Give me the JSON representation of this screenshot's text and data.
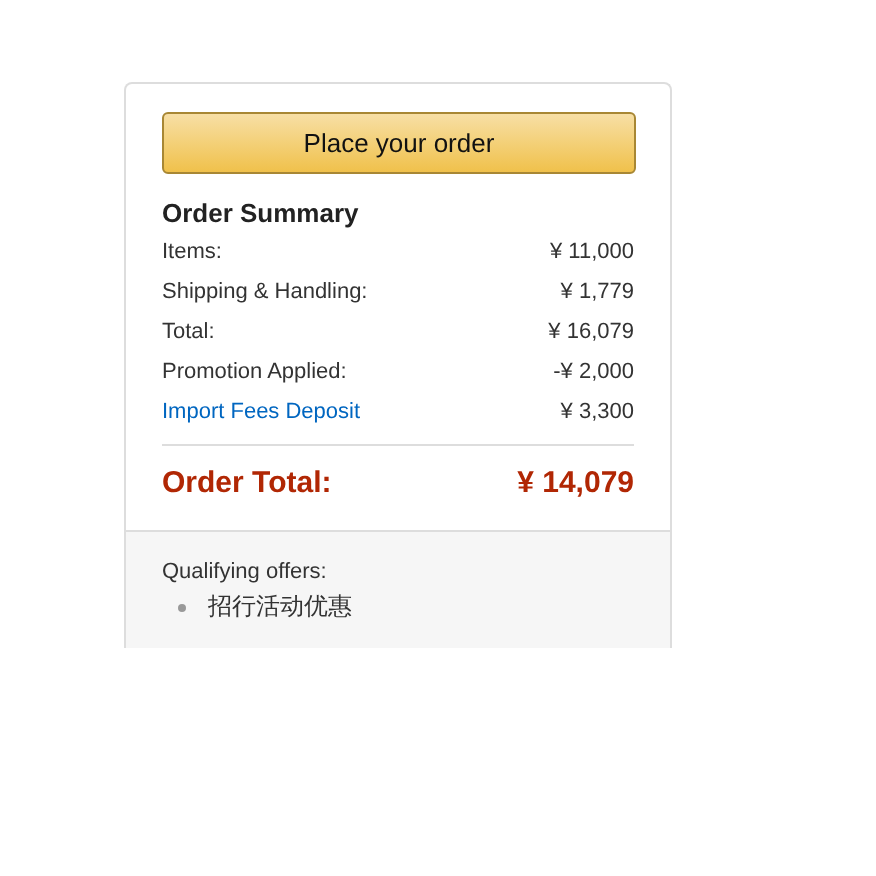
{
  "button": "Place your order",
  "summary": {
    "title": "Order Summary",
    "rows": [
      {
        "kind": "text",
        "label": "Items:",
        "value": "¥ 11,000"
      },
      {
        "kind": "text",
        "label": "Shipping & Handling:",
        "value": "¥ 1,779"
      },
      {
        "kind": "text",
        "label": "Total:",
        "value": "¥ 16,079"
      },
      {
        "kind": "text",
        "label": "Promotion Applied:",
        "value": "-¥ 2,000"
      },
      {
        "kind": "link",
        "label": "Import Fees Deposit",
        "value": "¥ 3,300"
      }
    ]
  },
  "order_total": {
    "label": "Order Total:",
    "value": "¥ 14,079"
  },
  "offers": {
    "title": "Qualifying offers:",
    "items": [
      "招行活动优惠"
    ]
  }
}
